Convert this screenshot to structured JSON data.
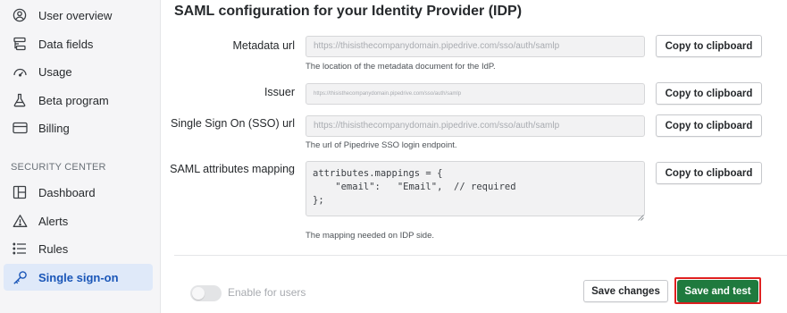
{
  "sidebar": {
    "items": [
      {
        "label": "User overview",
        "icon": "user-circle-icon"
      },
      {
        "label": "Data fields",
        "icon": "data-fields-icon"
      },
      {
        "label": "Usage",
        "icon": "gauge-icon"
      },
      {
        "label": "Beta program",
        "icon": "flask-icon"
      },
      {
        "label": "Billing",
        "icon": "credit-card-icon"
      }
    ],
    "security_heading": "SECURITY CENTER",
    "security_items": [
      {
        "label": "Dashboard",
        "icon": "dashboard-icon"
      },
      {
        "label": "Alerts",
        "icon": "alert-triangle-icon"
      },
      {
        "label": "Rules",
        "icon": "list-icon"
      },
      {
        "label": "Single sign-on",
        "icon": "key-icon",
        "active": true
      }
    ]
  },
  "main": {
    "title": "SAML configuration for your Identity Provider (IDP)",
    "fields": {
      "metadata": {
        "label": "Metadata url",
        "value": "https://thisisthecompanydomain.pipedrive.com/sso/auth/samlp",
        "help": "The location of the metadata document for the IdP."
      },
      "issuer": {
        "label": "Issuer",
        "value": "https://thisisthecompanydomain.pipedrive.com/sso/auth/samlp"
      },
      "sso": {
        "label": "Single Sign On (SSO) url",
        "value": "https://thisisthecompanydomain.pipedrive.com/sso/auth/samlp",
        "help": "The url of Pipedrive SSO login endpoint."
      },
      "mapping": {
        "label": "SAML attributes mapping",
        "value": "attributes.mappings = {\n    \"email\":   \"Email\",  // required\n};",
        "help": "The mapping needed on IDP side."
      }
    },
    "copy_label": "Copy to clipboard",
    "footer": {
      "toggle_label": "Enable for users",
      "toggle_on": false,
      "save_changes": "Save changes",
      "save_and_test": "Save and test"
    }
  },
  "colors": {
    "accent": "#1a56b8",
    "active_bg": "#dfe9f9",
    "primary_button": "#1f7a3e",
    "highlight_outline": "#e02020"
  }
}
